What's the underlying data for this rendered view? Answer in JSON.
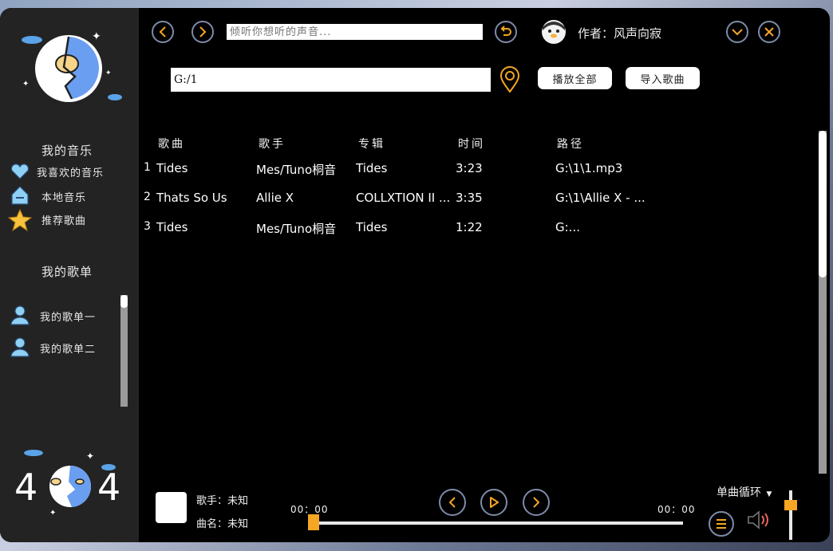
{
  "top_bar": {
    "search_placeholder": "倾听你想听的声音...",
    "author_label": "作者：风声向寂"
  },
  "path_bar": {
    "path_value": "G:/1",
    "play_all_label": "播放全部",
    "import_label": "导入歌曲"
  },
  "sidebar": {
    "my_music_title": "我的音乐",
    "items": [
      {
        "label": "我喜欢的音乐",
        "icon": "heart-icon"
      },
      {
        "label": "本地音乐",
        "icon": "house-icon"
      },
      {
        "label": "推荐歌曲",
        "icon": "star-icon"
      }
    ],
    "playlists_title": "我的歌单",
    "playlists": [
      {
        "label": "我的歌单一",
        "icon": "user-icon"
      },
      {
        "label": "我的歌单二",
        "icon": "user-icon"
      }
    ],
    "logo_404_text": [
      "4",
      "4"
    ]
  },
  "table": {
    "headers": [
      "歌曲",
      "歌手",
      "专辑",
      "时间",
      "路径"
    ],
    "rows": [
      {
        "index": "1",
        "title": "Tides",
        "artist": "Mes/Tuno桐音",
        "album": "Tides",
        "time": "3:23",
        "path": "G:\\1\\1.mp3"
      },
      {
        "index": "2",
        "title": "Thats So Us",
        "artist": "Allie X",
        "album": "COLLXTION II ...",
        "time": "3:35",
        "path": "G:\\1\\Allie X - ..."
      },
      {
        "index": "3",
        "title": "Tides",
        "artist": "Mes/Tuno桐音",
        "album": "Tides",
        "time": "1:22",
        "path": "G:..."
      }
    ]
  },
  "player": {
    "singer_label": "歌手：未知",
    "song_label": "曲名：未知",
    "time_current": "00：00",
    "time_total": "00：00",
    "loop_mode": "单曲循环",
    "progress_fraction": 0,
    "volume_fraction": 0.75
  },
  "colors": {
    "accent_orange": "#f5a623",
    "button_border": "#7e8aa8",
    "sidebar_bg": "#232323",
    "main_bg": "#000000"
  }
}
